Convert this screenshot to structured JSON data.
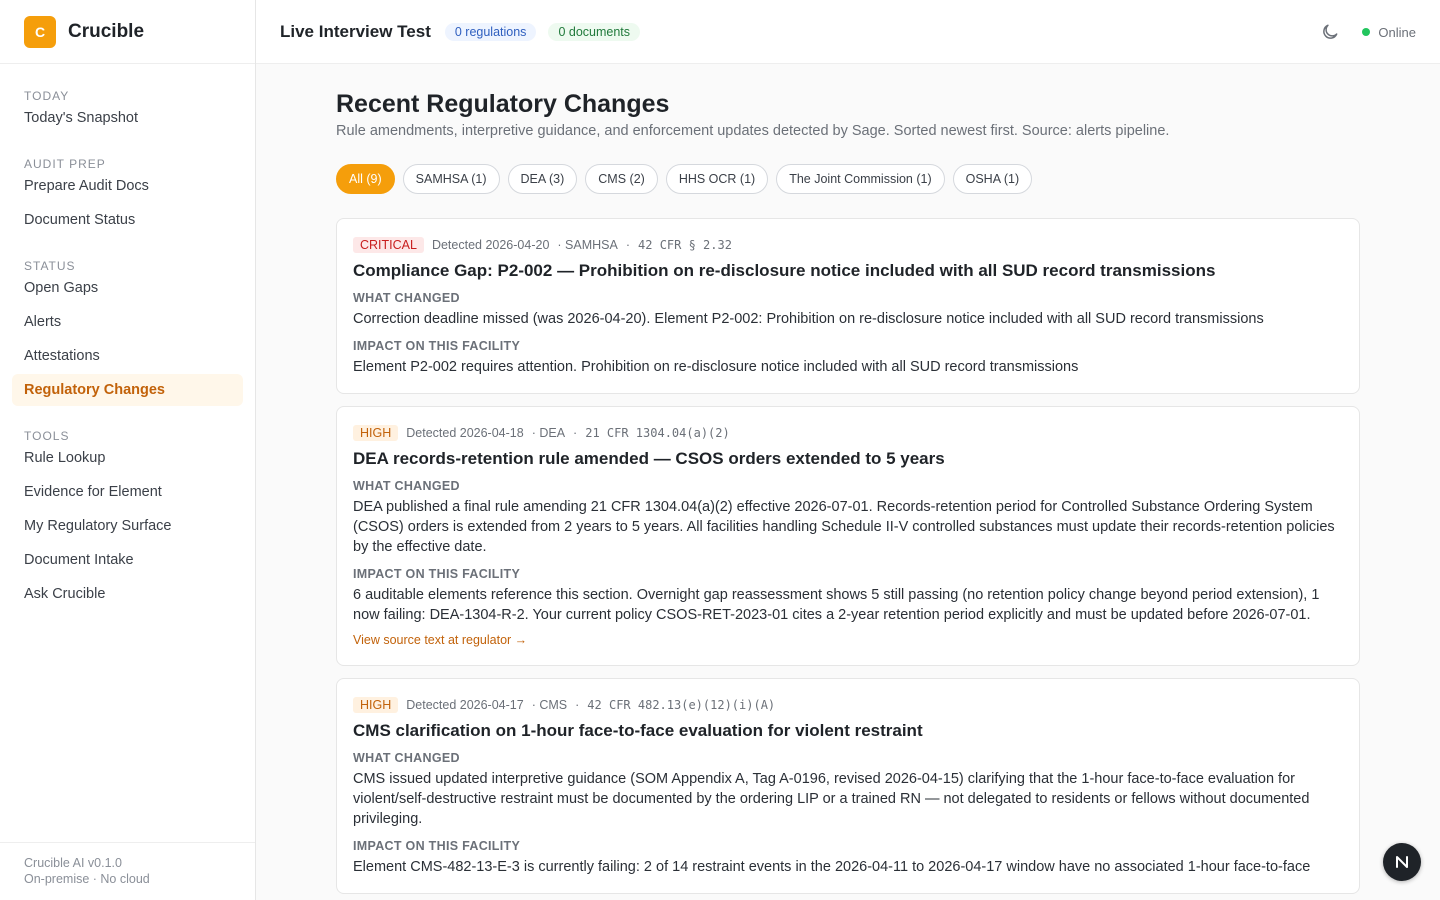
{
  "app": {
    "logo_letter": "C",
    "name": "Crucible"
  },
  "sidebar": {
    "sections": [
      {
        "title": "Today",
        "items": [
          {
            "label": "Today's Snapshot"
          }
        ]
      },
      {
        "title": "Audit Prep",
        "items": [
          {
            "label": "Prepare Audit Docs"
          },
          {
            "label": "Document Status"
          }
        ]
      },
      {
        "title": "Status",
        "items": [
          {
            "label": "Open Gaps"
          },
          {
            "label": "Alerts"
          },
          {
            "label": "Attestations"
          },
          {
            "label": "Regulatory Changes",
            "active": true
          }
        ]
      },
      {
        "title": "Tools",
        "items": [
          {
            "label": "Rule Lookup"
          },
          {
            "label": "Evidence for Element"
          },
          {
            "label": "My Regulatory Surface"
          },
          {
            "label": "Document Intake"
          },
          {
            "label": "Ask Crucible"
          }
        ]
      }
    ],
    "footer": {
      "version": "Crucible AI v0.1.0",
      "note": "On-premise · No cloud"
    }
  },
  "topbar": {
    "title": "Live Interview Test",
    "regulations_pill": "0 regulations",
    "documents_pill": "0 documents",
    "theme_icon": "moon-icon",
    "status": "Online",
    "status_color": "#22c55e"
  },
  "main": {
    "title": "Recent Regulatory Changes",
    "subtitle": "Rule amendments, interpretive guidance, and enforcement updates detected by Sage. Sorted newest first. Source: alerts pipeline.",
    "filters": [
      {
        "label": "All (9)",
        "active": true
      },
      {
        "label": "SAMHSA (1)"
      },
      {
        "label": "DEA (3)"
      },
      {
        "label": "CMS (2)"
      },
      {
        "label": "HHS OCR (1)"
      },
      {
        "label": "The Joint Commission (1)"
      },
      {
        "label": "OSHA (1)"
      }
    ],
    "what_changed_label": "What changed",
    "impact_label": "Impact on this facility",
    "changes": [
      {
        "severity": "Critical",
        "detected": "Detected 2026-04-20",
        "agency": "· SAMHSA",
        "dot": "·",
        "citation": "42 CFR § 2.32",
        "title": "Compliance Gap: P2-002 — Prohibition on re-disclosure notice included with all SUD record transmissions",
        "what_changed": "Correction deadline missed (was 2026-04-20). Element P2-002: Prohibition on re-disclosure notice included with all SUD record transmissions",
        "impact": "Element P2-002 requires attention. Prohibition on re-disclosure notice included with all SUD record transmissions",
        "link": ""
      },
      {
        "severity": "High",
        "detected": "Detected 2026-04-18",
        "agency": "· DEA",
        "dot": "·",
        "citation": "21 CFR 1304.04(a)(2)",
        "title": "DEA records-retention rule amended — CSOS orders extended to 5 years",
        "what_changed": "DEA published a final rule amending 21 CFR 1304.04(a)(2) effective 2026-07-01. Records-retention period for Controlled Substance Ordering System (CSOS) orders is extended from 2 years to 5 years. All facilities handling Schedule II-V controlled substances must update their records-retention policies by the effective date.",
        "impact": "6 auditable elements reference this section. Overnight gap reassessment shows 5 still passing (no retention policy change beyond period extension), 1 now failing: DEA-1304-R-2. Your current policy CSOS-RET-2023-01 cites a 2-year retention period explicitly and must be updated before 2026-07-01.",
        "link": "View source text at regulator →"
      },
      {
        "severity": "High",
        "detected": "Detected 2026-04-17",
        "agency": "· CMS",
        "dot": "·",
        "citation": "42 CFR 482.13(e)(12)(i)(A)",
        "title": "CMS clarification on 1-hour face-to-face evaluation for violent restraint",
        "what_changed": "CMS issued updated interpretive guidance (SOM Appendix A, Tag A-0196, revised 2026-04-15) clarifying that the 1-hour face-to-face evaluation for violent/self-destructive restraint must be documented by the ordering LIP or a trained RN — not delegated to residents or fellows without documented privileging.",
        "impact": "Element CMS-482-13-E-3 is currently failing: 2 of 14 restraint events in the 2026-04-11 to 2026-04-17 window have no associated 1-hour face-to-face",
        "link": ""
      }
    ]
  }
}
